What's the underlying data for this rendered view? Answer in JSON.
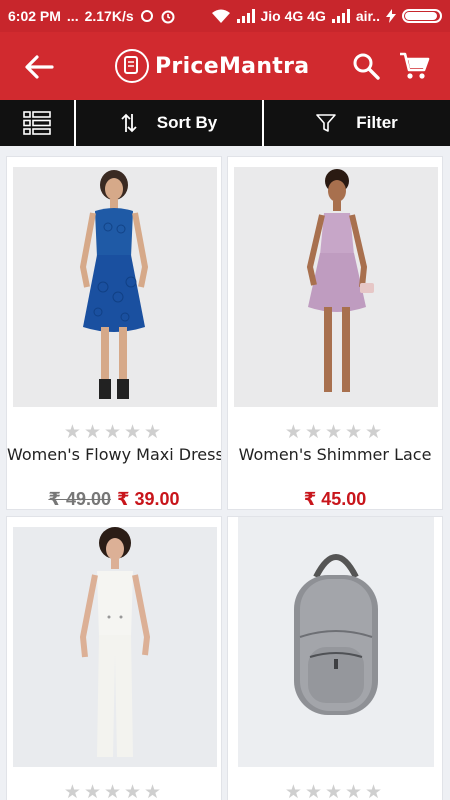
{
  "status_bar": {
    "time": "6:02 PM",
    "dots": "...",
    "speed": "2.17K/s",
    "carrier1": "Jio 4G 4G",
    "carrier2": "air..",
    "battery_level": 0.95
  },
  "app_bar": {
    "brand_name": "PriceMantra",
    "icons": [
      "back-arrow-icon",
      "pricemantra-logo",
      "search-icon",
      "cart-icon"
    ]
  },
  "toolbar": {
    "view_icon": "list-view-icon",
    "sort_label": "Sort By",
    "filter_label": "Filter"
  },
  "products": [
    {
      "title": "Women's Flowy Maxi Dress",
      "old_price": "₹ 49.00",
      "price": "₹ 39.00",
      "rating": 0,
      "image": "blue-lace-dress"
    },
    {
      "title": "Women's Shimmer Lace",
      "old_price": "",
      "price": "₹ 45.00",
      "rating": 0,
      "image": "pink-lace-dress"
    },
    {
      "title": "",
      "old_price": "",
      "price": "",
      "rating": 0,
      "image": "white-jumpsuit"
    },
    {
      "title": "",
      "old_price": "",
      "price": "",
      "rating": 0,
      "image": "silver-backpack"
    }
  ],
  "colors": {
    "brand_red": "#d12a2f",
    "status_red": "#c8262c",
    "toolbar_black": "#111111",
    "price_red": "#c8151b"
  }
}
